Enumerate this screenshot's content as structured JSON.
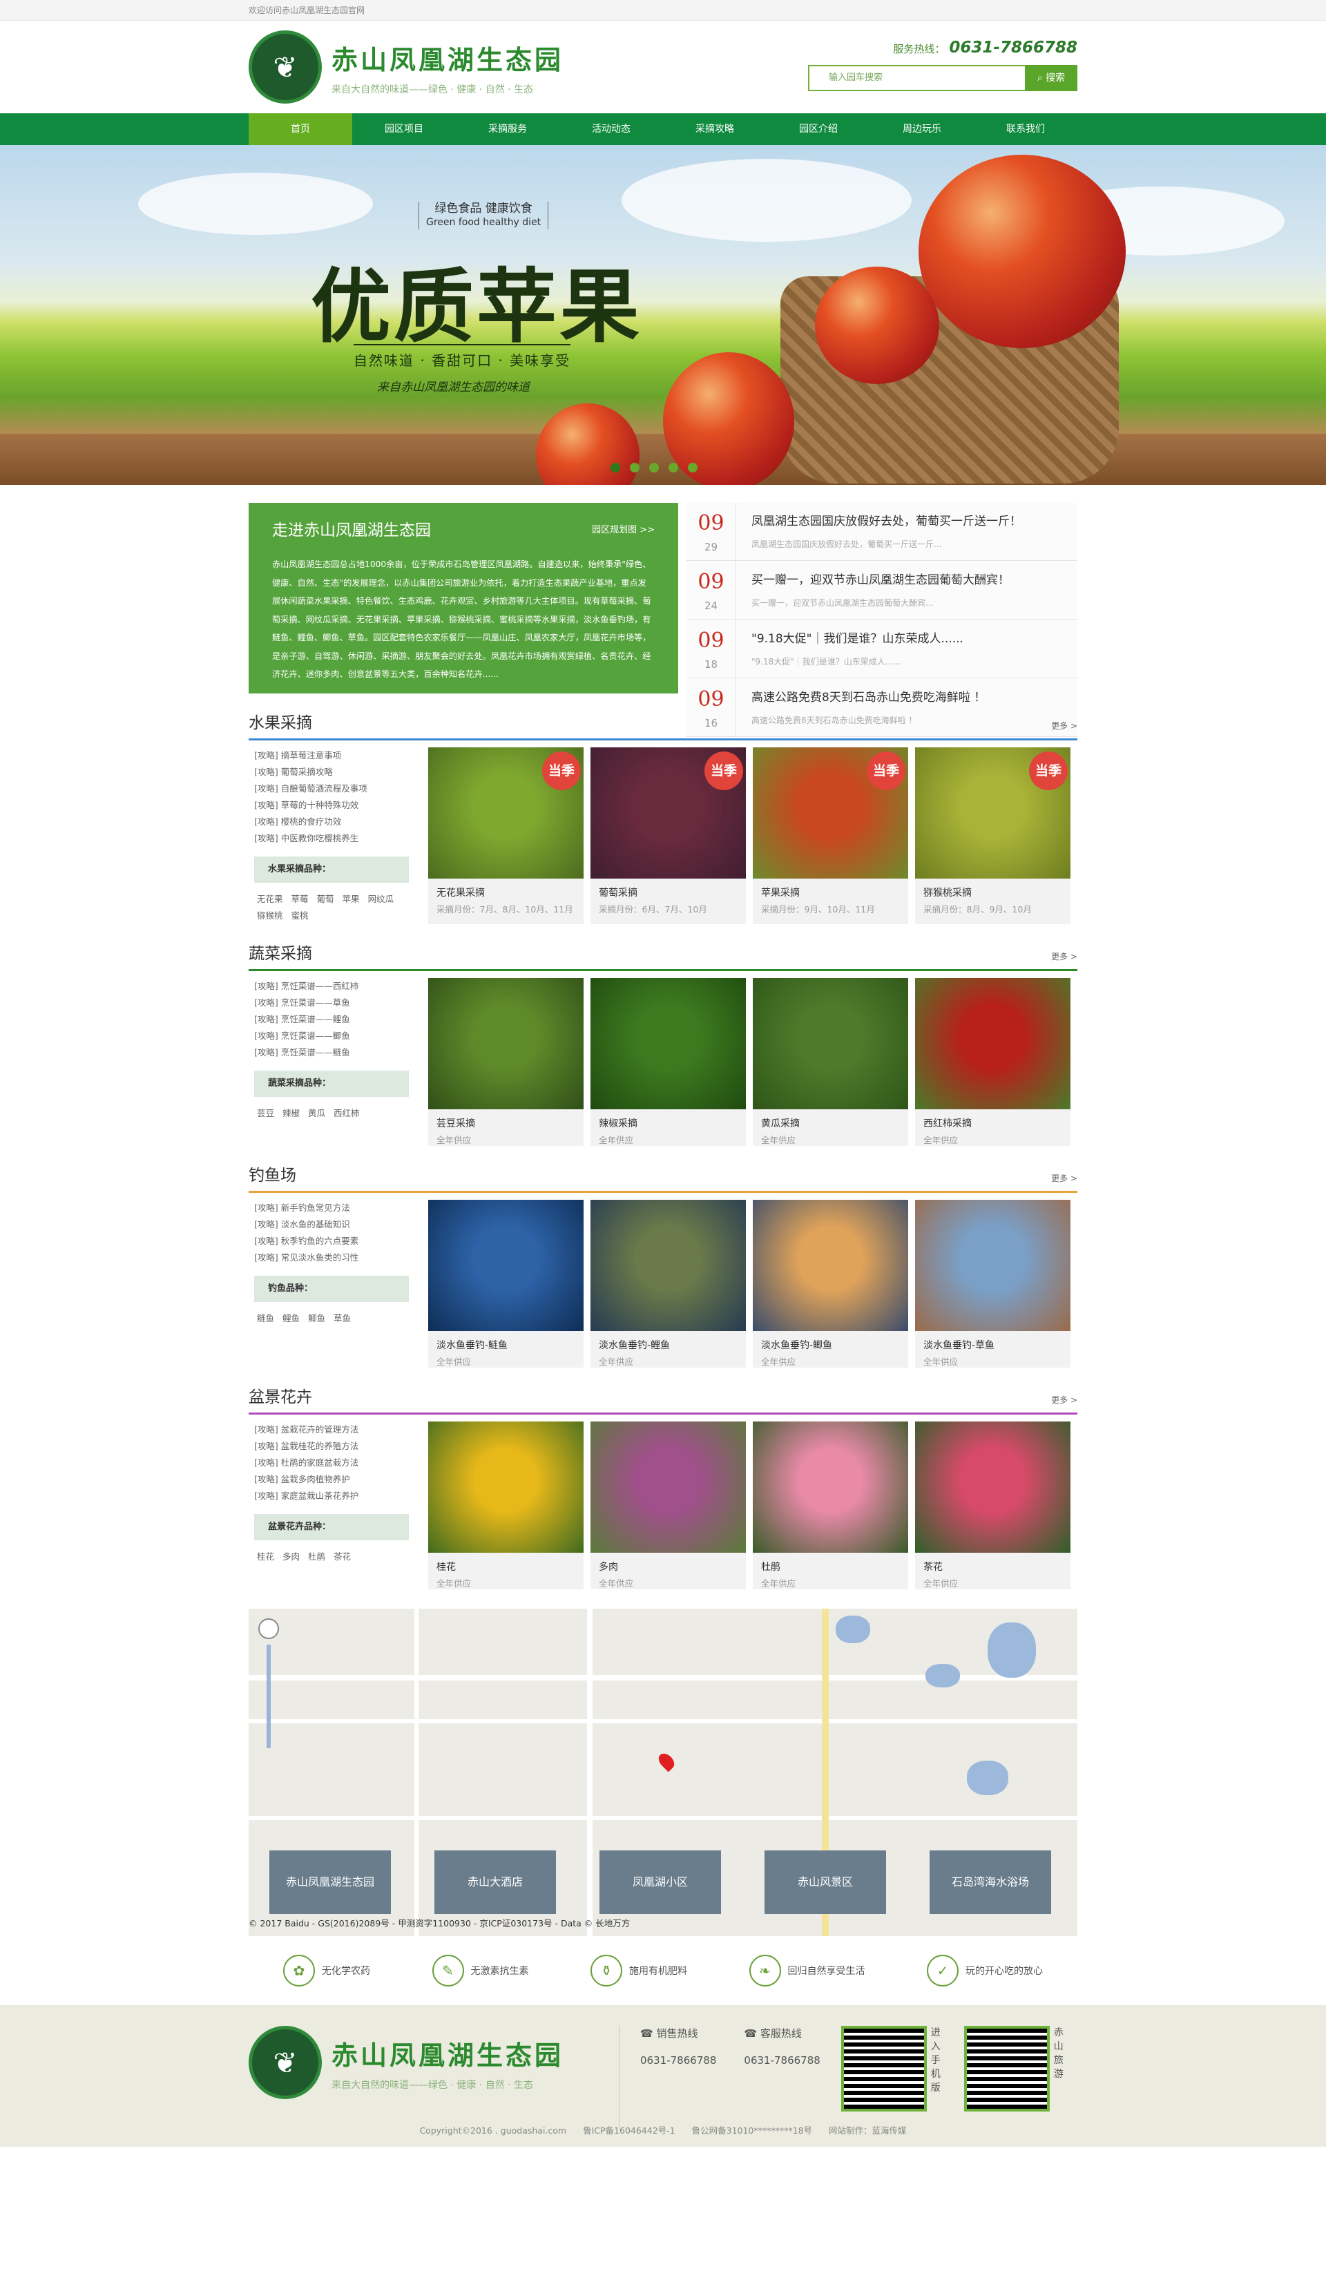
{
  "topbar": {
    "welcome": "欢迎访问赤山凤凰湖生态园官网"
  },
  "header": {
    "site_name": "赤山凤凰湖生态园",
    "slogan": "来自大自然的味道——绿色 · 健康 · 自然 · 生态",
    "hotline_label": "服务热线：",
    "hotline": "0631-7866788",
    "search_placeholder": "输入园车搜索",
    "search_button": "搜索"
  },
  "nav": [
    "首页",
    "园区项目",
    "采摘服务",
    "活动动态",
    "采摘攻略",
    "园区介绍",
    "周边玩乐",
    "联系我们"
  ],
  "banner": {
    "small1": "绿色食品  健康饮食",
    "small2": "Green food healthy diet",
    "big": "优质苹果",
    "sub": "自然味道 · 香甜可口 · 美味享受",
    "sig": "来自赤山凤凰湖生态园的味道"
  },
  "intro": {
    "title": "走进赤山凤凰湖生态园",
    "more": "园区规划图 >>",
    "text": "赤山凤凰湖生态园总占地1000余亩，位于荣成市石岛管理区凤凰湖路。自建造以来，始终秉承\"绿色、健康、自然、生态\"的发展理念，以赤山集团公司旅游业为依托，着力打造生态果蔬产业基地，重点发展休闲蔬菜水果采摘、特色餐饮、生态鸡鹿、花卉观赏、乡村旅游等几大主体项目。现有草莓采摘、葡萄采摘、网纹瓜采摘、无花果采摘、苹果采摘、猕猴桃采摘、蜜桃采摘等水果采摘，淡水鱼垂钓场，有鲢鱼、鲤鱼、鲫鱼、草鱼。园区配套特色农家乐餐厅——凤凰山庄、凤凰农家大厅，凤凰花卉市场等，是亲子游、自驾游、休闲游、采摘游、朋友聚会的好去处。凤凰花卉市场拥有观赏绿植、名贵花卉、经济花卉、迷你多肉、创意盆景等五大类，百余种知名花卉......"
  },
  "news": [
    {
      "day": "09",
      "month": "29",
      "title": "凤凰湖生态园国庆放假好去处，葡萄买一斤送一斤！",
      "sub": "凤凰湖生态园国庆放假好去处，葡萄买一斤送一斤..."
    },
    {
      "day": "09",
      "month": "24",
      "title": "买一赠一，迎双节赤山凤凰湖生态园葡萄大酬宾！",
      "sub": "买一赠一，迎双节赤山凤凰湖生态园葡萄大酬宾..."
    },
    {
      "day": "09",
      "month": "18",
      "title": "\"9.18大促\"｜我们是谁？山东荣成人......",
      "sub": "\"9.18大促\"｜我们是谁？山东荣成人......"
    },
    {
      "day": "09",
      "month": "16",
      "title": "高速公路免费8天到石岛赤山免费吃海鲜啦 ！",
      "sub": "高速公路免费8天到石岛赤山免费吃海鲜啦 ！"
    }
  ],
  "categories": [
    {
      "title": "水果采摘",
      "more": "更多 >",
      "color": "#3a8ad0",
      "links": [
        "[攻略] 摘草莓注意事项",
        "[攻略] 葡萄采摘攻略",
        "[攻略] 自酿葡萄酒流程及事项",
        "[攻略] 草莓的十种特殊功效",
        "[攻略] 樱桃的食疗功效",
        "[攻略] 中医教你吃樱桃养生"
      ],
      "ph_title": "水果采摘品种：",
      "tags": [
        "无花果",
        "草莓",
        "葡萄",
        "苹果",
        "网纹瓜",
        "猕猴桃",
        "蜜桃"
      ],
      "cards": [
        {
          "name": "无花果采摘",
          "time": "采摘月份：7月、8月、10月、11月",
          "badge": "当季"
        },
        {
          "name": "葡萄采摘",
          "time": "采摘月份：6月、7月、10月",
          "badge": "当季"
        },
        {
          "name": "苹果采摘",
          "time": "采摘月份：9月、10月、11月",
          "badge": "当季"
        },
        {
          "name": "猕猴桃采摘",
          "time": "采摘月份：8月、9月、10月",
          "badge": "当季"
        }
      ]
    },
    {
      "title": "蔬菜采摘",
      "more": "更多 >",
      "color": "#2c8a2a",
      "links": [
        "[攻略] 烹饪菜谱——西红柿",
        "[攻略] 烹饪菜谱——草鱼",
        "[攻略] 烹饪菜谱——鲤鱼",
        "[攻略] 烹饪菜谱——鲫鱼",
        "[攻略] 烹饪菜谱——鲢鱼"
      ],
      "ph_title": "蔬菜采摘品种：",
      "tags": [
        "芸豆",
        "辣椒",
        "黄瓜",
        "西红柿"
      ],
      "cards": [
        {
          "name": "芸豆采摘",
          "time": "全年供应",
          "badge": ""
        },
        {
          "name": "辣椒采摘",
          "time": "全年供应",
          "badge": ""
        },
        {
          "name": "黄瓜采摘",
          "time": "全年供应",
          "badge": ""
        },
        {
          "name": "西红柿采摘",
          "time": "全年供应",
          "badge": ""
        }
      ]
    },
    {
      "title": "钓鱼场",
      "more": "更多 >",
      "color": "#e8a23a",
      "links": [
        "[攻略] 新手钓鱼常见方法",
        "[攻略] 淡水鱼的基础知识",
        "[攻略] 秋季钓鱼的六点要素",
        "[攻略] 常见淡水鱼类的习性"
      ],
      "ph_title": "钓鱼品种：",
      "tags": [
        "鲢鱼",
        "鲤鱼",
        "鲫鱼",
        "草鱼"
      ],
      "cards": [
        {
          "name": "淡水鱼垂钓-鲢鱼",
          "time": "全年供应",
          "badge": ""
        },
        {
          "name": "淡水鱼垂钓-鲤鱼",
          "time": "全年供应",
          "badge": ""
        },
        {
          "name": "淡水鱼垂钓-鲫鱼",
          "time": "全年供应",
          "badge": ""
        },
        {
          "name": "淡水鱼垂钓-草鱼",
          "time": "全年供应",
          "badge": ""
        }
      ]
    },
    {
      "title": "盆景花卉",
      "more": "更多 >",
      "color": "#b04ab8",
      "links": [
        "[攻略] 盆栽花卉的管理方法",
        "[攻略] 盆栽桂花的养殖方法",
        "[攻略] 杜鹃的家庭盆栽方法",
        "[攻略] 盆栽多肉植物养护",
        "[攻略] 家庭盆栽山茶花养护"
      ],
      "ph_title": "盆景花卉品种：",
      "tags": [
        "桂花",
        "多肉",
        "杜鹃",
        "茶花"
      ],
      "cards": [
        {
          "name": "桂花",
          "time": "全年供应",
          "badge": ""
        },
        {
          "name": "多肉",
          "time": "全年供应",
          "badge": ""
        },
        {
          "name": "杜鹃",
          "time": "全年供应",
          "badge": ""
        },
        {
          "name": "茶花",
          "time": "全年供应",
          "badge": ""
        }
      ]
    }
  ],
  "map": {
    "thumbs": [
      "赤山凤凰湖生态园",
      "赤山大酒店",
      "凤凰湖小区",
      "赤山风景区",
      "石岛湾海水浴场"
    ],
    "copyright": "© 2017 Baidu - GS(2016)2089号 - 甲测资字1100930 - 京ICP证030173号 - Data © 长地万方"
  },
  "features": [
    "无化学农药",
    "无激素抗生素",
    "施用有机肥料",
    "回归自然享受生活",
    "玩的开心吃的放心"
  ],
  "footer": {
    "site_name": "赤山凤凰湖生态园",
    "slogan": "来自大自然的味道——绿色 · 健康 · 自然 · 生态",
    "sales_label": "销售热线",
    "sales": "0631-7866788",
    "service_label": "客服热线",
    "service": "0631-7866788",
    "qr1": "进入手机版",
    "qr2": "赤山旅游",
    "copyright": "Copyright©2016 . guodashai.com",
    "icp": "鲁ICP备16046442号-1",
    "police": "鲁公网备31010*********18号",
    "maker": "网站制作：蓝海传媒"
  },
  "colors": {
    "nav": "#0f8a3e",
    "accent": "#65ae20",
    "intro": "#55a33c",
    "date": "#c92a20"
  }
}
